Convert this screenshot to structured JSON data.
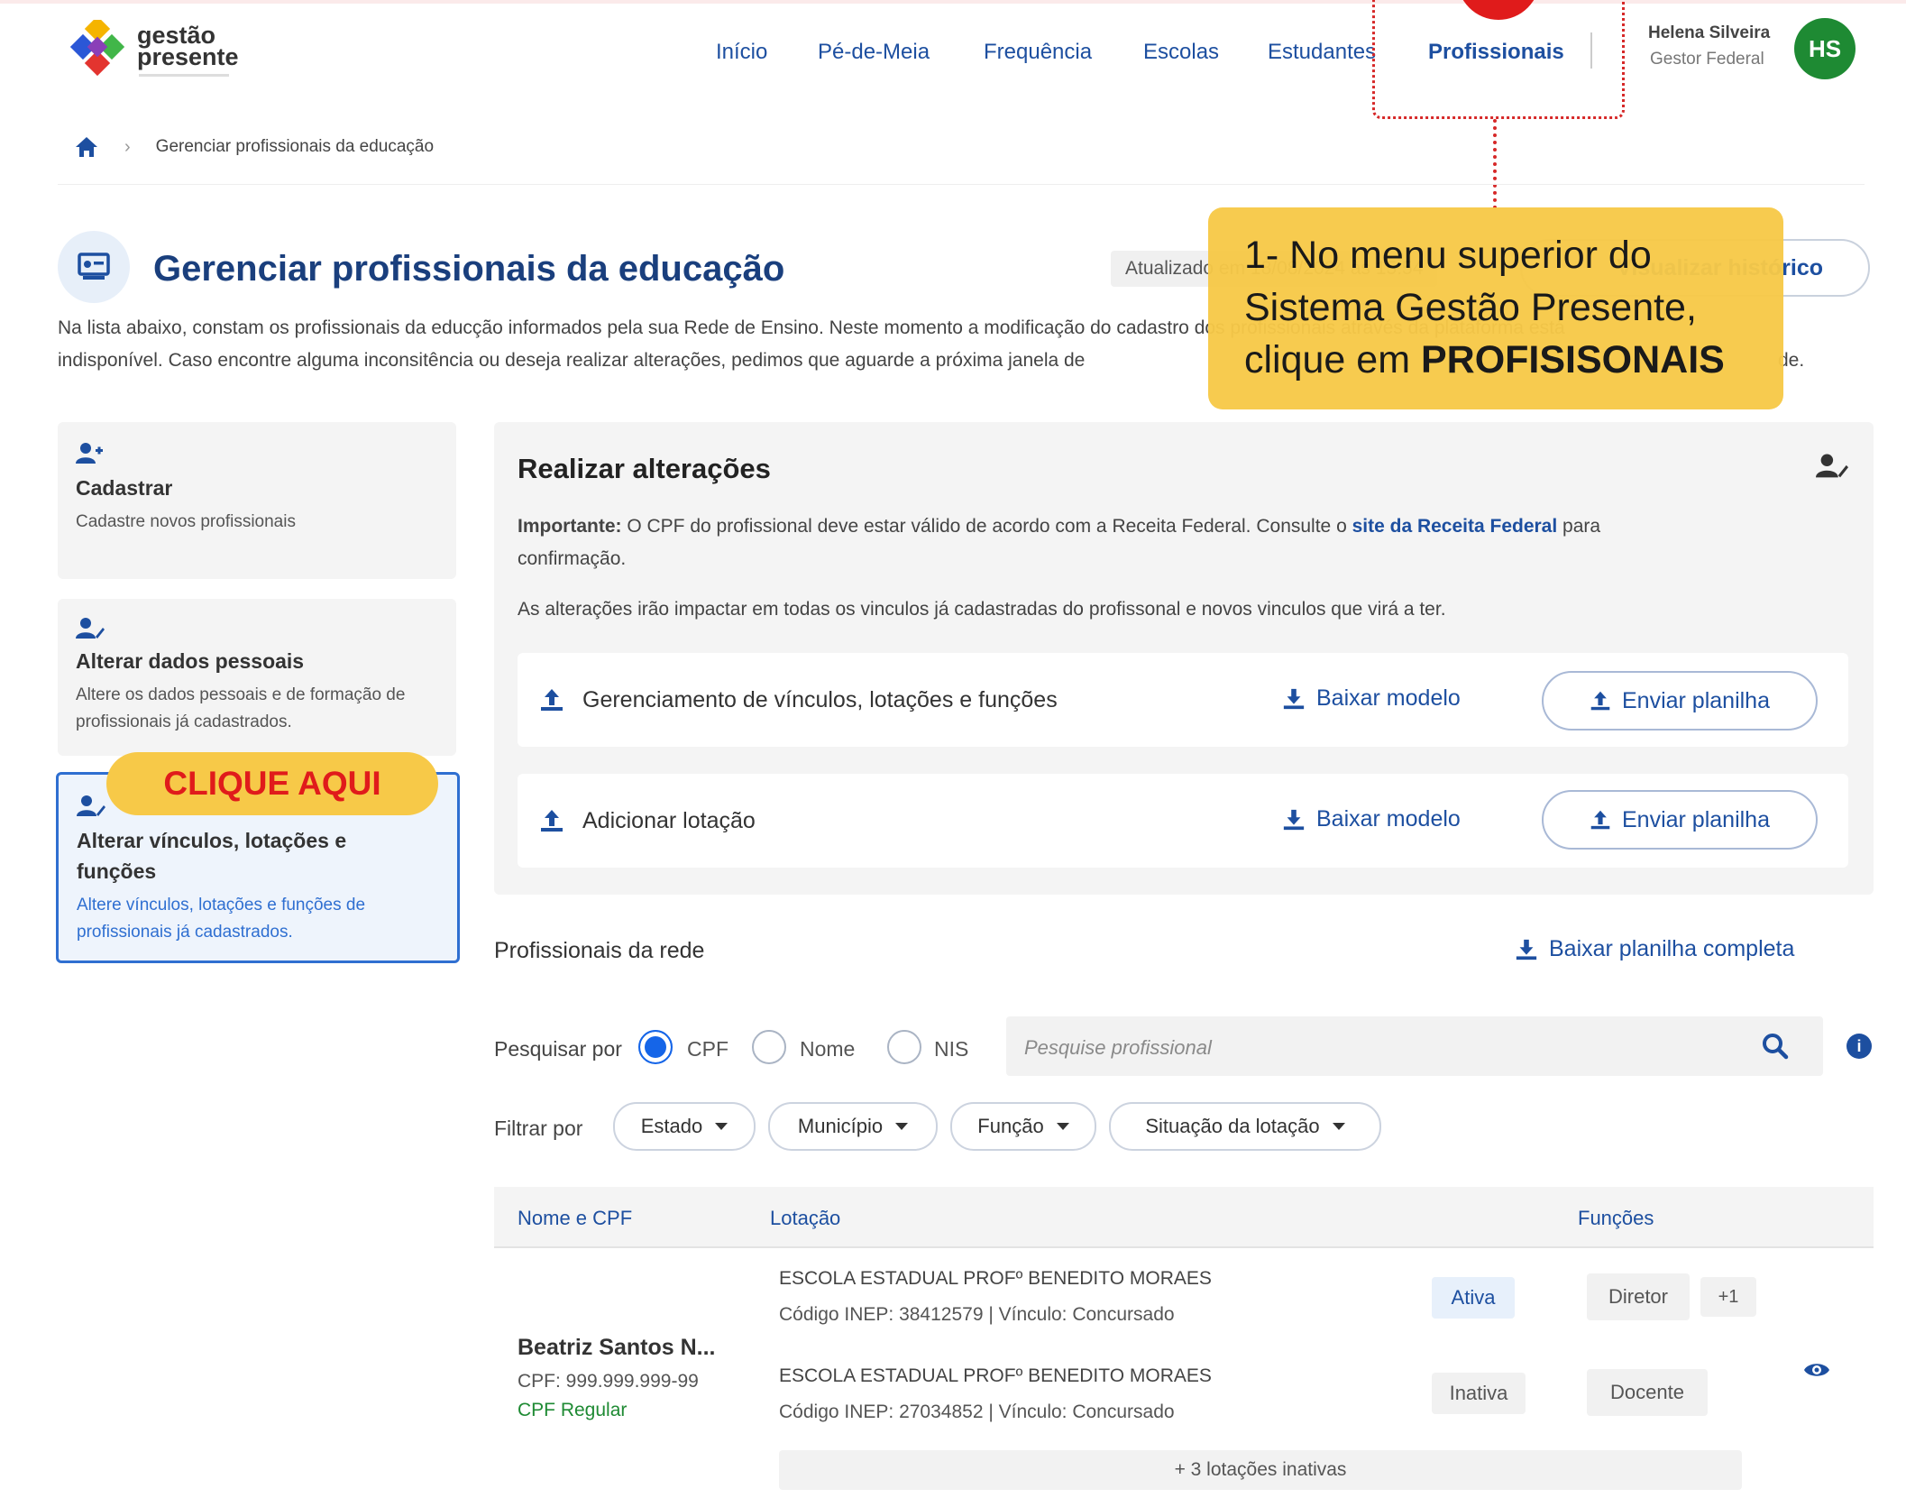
{
  "logo": {
    "line1": "gestão",
    "line2": "presente"
  },
  "nav": {
    "items": [
      "Início",
      "Pé-de-Meia",
      "Frequência",
      "Escolas",
      "Estudantes",
      "Profissionais"
    ]
  },
  "user": {
    "name": "Helena Silveira",
    "role": "Gestor Federal",
    "initials": "HS"
  },
  "breadcrumb": {
    "current": "Gerenciar profissionais da educação"
  },
  "page": {
    "title": "Gerenciar profissionais da educação",
    "updated": "Atualizado em 18/08/2024 às 15:54",
    "history_button": "Visualizar histórico",
    "desc_line1": "Na lista abaixo, constam os profissionais da educção informados pela sua Rede de Ensino. Neste momento a modificação do cadastro dos profissionais através da plataforma está",
    "desc_line2": "indisponível. Caso encontre alguma inconsitência ou deseja realizar alterações, pedimos que aguarde a próxima janela de"
  },
  "annotation": {
    "line1": "1- No menu superior do",
    "line2": "Sistema Gestão Presente,",
    "line3_prefix": "clique em ",
    "line3_bold": "PROFISISONAIS",
    "trailing": "de."
  },
  "click_here": "CLIQUE AQUI",
  "sidebar": {
    "items": [
      {
        "title": "Cadastrar",
        "desc1": "Cadastre novos profissionais",
        "desc2": ""
      },
      {
        "title": "Alterar dados pessoais",
        "desc1": "Altere os dados pessoais e de formação de",
        "desc2": "profissionais já cadastrados."
      },
      {
        "title1": "Alterar vínculos, lotações e",
        "title2": "funções",
        "desc1": "Altere vínculos, lotações e funções de",
        "desc2": "profissionais já cadastrados."
      }
    ]
  },
  "changes": {
    "title": "Realizar alterações",
    "important_label": "Importante:",
    "important_text": " O CPF do profissional deve estar válido de acordo com a Receita Federal. Consulte o ",
    "important_link": "site da Receita Federal",
    "important_after": " para",
    "important_line2": "confirmação.",
    "impact": "As alterações irão impactar em todas os vinculos já cadastradas do profissonal e novos vinculos que virá a ter.",
    "rows": [
      {
        "label": "Gerenciamento de vínculos, lotações e funções",
        "download": "Baixar modelo",
        "upload": "Enviar planilha"
      },
      {
        "label": "Adicionar lotação",
        "download": "Baixar modelo",
        "upload": "Enviar planilha"
      }
    ]
  },
  "network": {
    "title": "Profissionais da rede",
    "download_all": "Baixar planilha completa",
    "search_label": "Pesquisar por",
    "radio_cpf": "CPF",
    "radio_nome": "Nome",
    "radio_nis": "NIS",
    "search_placeholder": "Pesquise profissional",
    "filter_label": "Filtrar por",
    "filters": [
      "Estado",
      "Município",
      "Função",
      "Situação da lotação"
    ],
    "columns": {
      "name": "Nome e CPF",
      "lot": "Lotação",
      "func": "Funções"
    },
    "row": {
      "name": "Beatriz Santos N...",
      "cpf": "CPF: 999.999.999-99",
      "cpf_status": "CPF Regular",
      "lotacoes": [
        {
          "school": "ESCOLA ESTADUAL PROFº BENEDITO MORAES",
          "info": "Código INEP: 38412579 | Vínculo: Concursado",
          "status": "Ativa",
          "func": "Diretor",
          "extra": "+1"
        },
        {
          "school": "ESCOLA ESTADUAL PROFº BENEDITO MORAES",
          "info": "Código INEP: 27034852 | Vínculo: Concursado",
          "status": "Inativa",
          "func": "Docente",
          "extra": ""
        }
      ],
      "more": "+ 3 lotações inativas"
    }
  },
  "colors": {
    "primary": "#1d4fa0",
    "annotation": "#f7c948",
    "alert": "#e01b1b",
    "avatar": "#1e8a33"
  }
}
